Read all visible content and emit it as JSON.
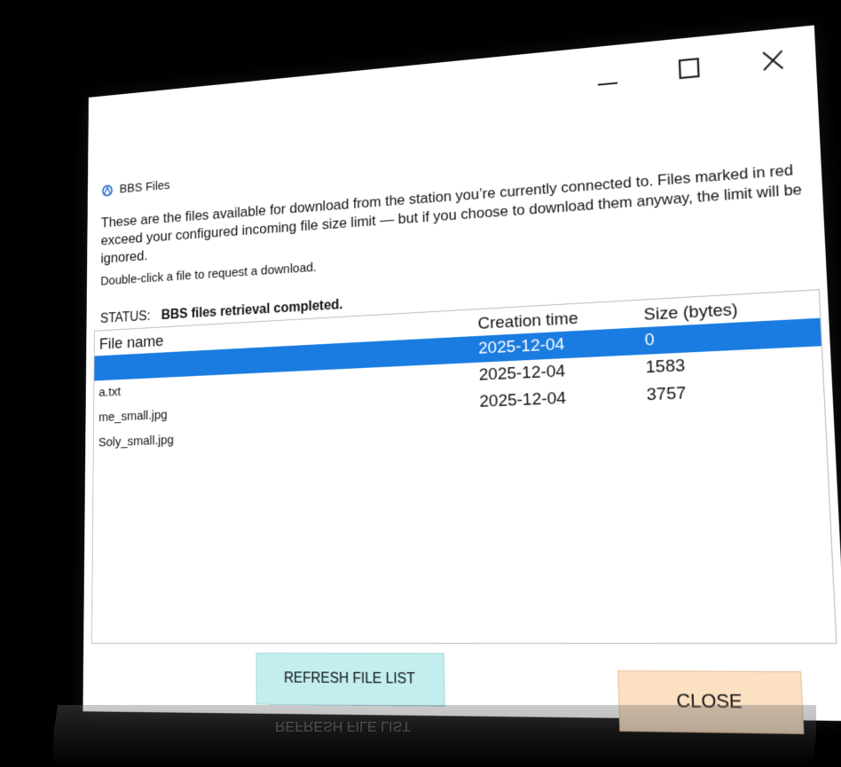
{
  "window": {
    "title": "BBS Files",
    "icon": "app-icon",
    "caption": {
      "minimize_icon": "minimize-icon",
      "maximize_icon": "maximize-icon",
      "close_icon": "close-icon"
    }
  },
  "description": "These are the files available for download from the station you’re currently connected to. Files marked in red exceed your configured incoming file size limit — but if you choose to download them anyway, the limit will be ignored.",
  "hint": "Double-click a file to request a download.",
  "status": {
    "label": "STATUS:",
    "value": "BBS files retrieval completed."
  },
  "table": {
    "columns": [
      "File name",
      "Creation time",
      "Size (bytes)"
    ],
    "rows": [
      {
        "name": "",
        "time": "2025-12-04",
        "size": "0"
      },
      {
        "name": "a.txt",
        "time": "2025-12-04",
        "size": "1583"
      },
      {
        "name": "me_small.jpg",
        "time": "2025-12-04",
        "size": "3757"
      },
      {
        "name": "Soly_small.jpg",
        "time": "",
        "size": ""
      }
    ]
  },
  "buttons": {
    "refresh": "REFRESH FILE LIST",
    "close": "CLOSE"
  },
  "colors": {
    "selection": "#1a7ce0",
    "refresh_bg": "#c3eef0",
    "close_bg": "#fbe0c2"
  }
}
